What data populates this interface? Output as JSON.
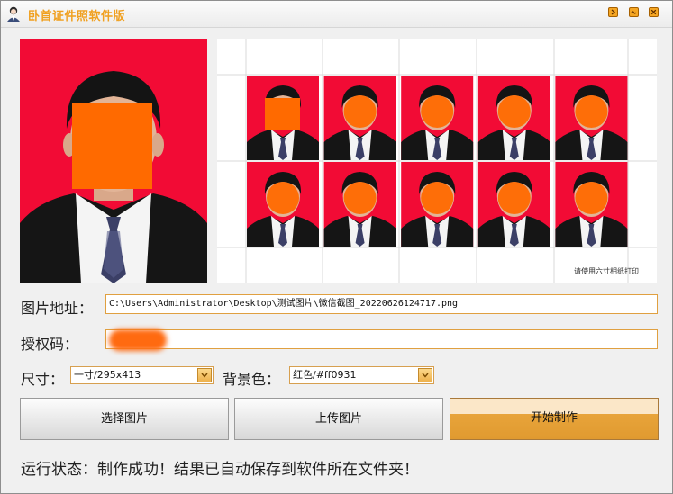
{
  "window": {
    "title": "卧首证件照软件版",
    "accent": "#f0a020"
  },
  "titlebar_buttons": [
    {
      "name": "restore-button",
      "icon": "window-restore-icon"
    },
    {
      "name": "minimize-button",
      "icon": "window-minimize-icon"
    },
    {
      "name": "close-button",
      "icon": "window-close-icon"
    }
  ],
  "preview": {
    "background_color": "#f20b35",
    "sheet_note": "请使用六寸相纸打印",
    "thumb_rows": 2,
    "thumb_cols": 5
  },
  "form": {
    "path_label": "图片地址：",
    "path_value": "C:\\Users\\Administrator\\Desktop\\测试图片\\微信截图_20220626124717.png",
    "auth_label": "授权码：",
    "auth_value": "",
    "size_label": "尺寸：",
    "size_value": "一寸/295x413",
    "bg_label": "背景色：",
    "bg_value": "红色/#ff0931"
  },
  "buttons": {
    "select": "选择图片",
    "upload": "上传图片",
    "start": "开始制作"
  },
  "status": {
    "label": "运行状态：",
    "message": "制作成功！结果已自动保存到软件所在文件夹！"
  }
}
